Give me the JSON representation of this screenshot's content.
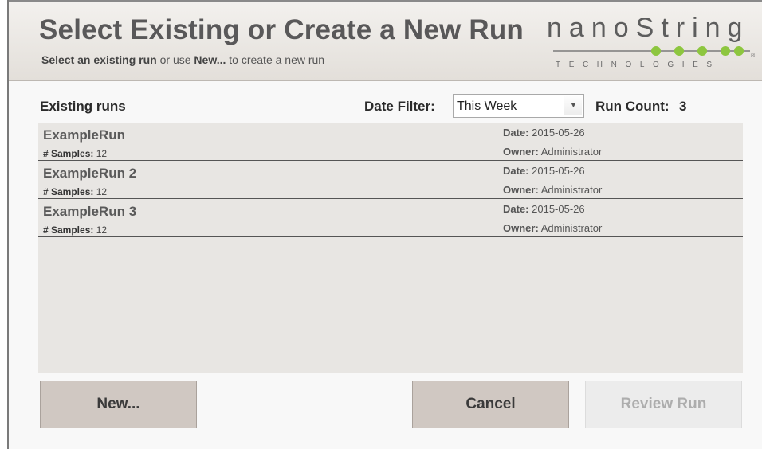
{
  "header": {
    "title": "Select Existing or Create a New Run",
    "subtitle_bold_1": "Select an existing run",
    "subtitle_text_1": " or use ",
    "subtitle_bold_2": "New...",
    "subtitle_text_2": " to create a new run",
    "logo_word": "nanoString",
    "logo_sub": "TECHNOLOGIES",
    "logo_mark": "®"
  },
  "toolbar": {
    "existing_label": "Existing runs",
    "date_filter_label": "Date Filter:",
    "date_filter_value": "This Week",
    "run_count_label": "Run Count:",
    "run_count_value": "3"
  },
  "runs": [
    {
      "name": "ExampleRun",
      "samples_label": "# Samples:",
      "samples": "12",
      "date_label": "Date:",
      "date": "2015-05-26",
      "owner_label": "Owner:",
      "owner": "Administrator"
    },
    {
      "name": "ExampleRun 2",
      "samples_label": "# Samples:",
      "samples": "12",
      "date_label": "Date:",
      "date": "2015-05-26",
      "owner_label": "Owner:",
      "owner": "Administrator"
    },
    {
      "name": "ExampleRun 3",
      "samples_label": "# Samples:",
      "samples": "12",
      "date_label": "Date:",
      "date": "2015-05-26",
      "owner_label": "Owner:",
      "owner": "Administrator"
    }
  ],
  "buttons": {
    "new": "New...",
    "cancel": "Cancel",
    "review": "Review Run"
  },
  "colors": {
    "header_bg": "#e8e5e1",
    "list_bg": "#e8e6e3",
    "button_bg": "#d0c8c2",
    "button_disabled_bg": "#ececec",
    "logo_green": "#8dc63f"
  }
}
